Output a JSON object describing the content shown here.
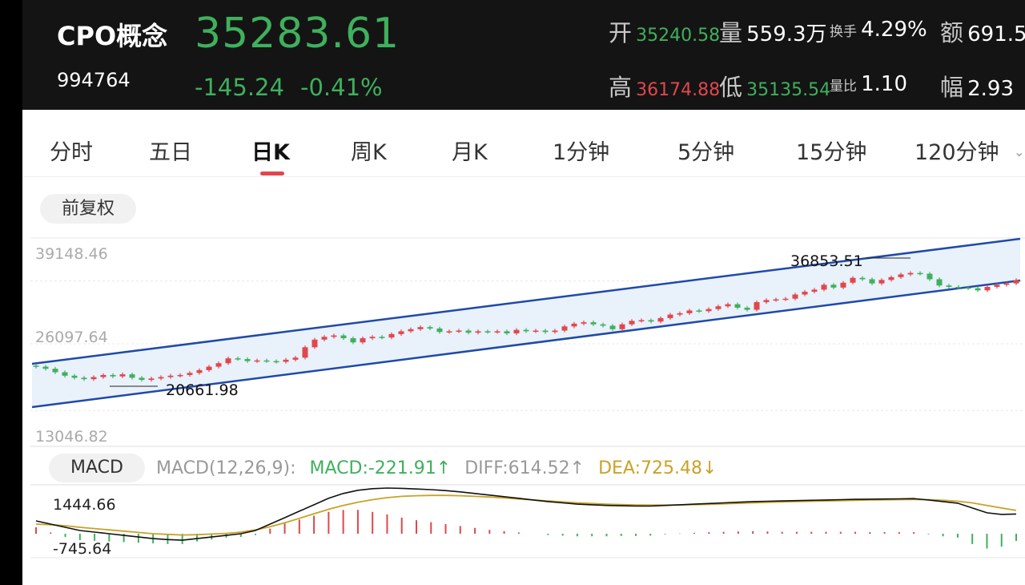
{
  "header": {
    "name": "CPO概念",
    "code": "994764",
    "price": "35283.61",
    "change": "-145.24",
    "change_pct": "-0.41%",
    "stats": {
      "open_label": "开",
      "open_value": "35240.58",
      "volume_label": "量",
      "volume_value": "559.3万",
      "turnover_label": "换手",
      "turnover_value": "4.29%",
      "amount_label": "额",
      "amount_value": "691.5",
      "high_label": "高",
      "high_value": "36174.88",
      "low_label": "低",
      "low_value": "35135.54",
      "vol_ratio_label": "量比",
      "vol_ratio_value": "1.10",
      "amplitude_label": "幅",
      "amplitude_value": "2.93"
    }
  },
  "tabs": [
    {
      "label": "分时"
    },
    {
      "label": "五日"
    },
    {
      "label": "日K"
    },
    {
      "label": "周K"
    },
    {
      "label": "月K"
    },
    {
      "label": "1分钟"
    },
    {
      "label": "5分钟"
    },
    {
      "label": "15分钟"
    },
    {
      "label": "120分钟"
    }
  ],
  "active_tab": "日K",
  "adjust_button": "前复权",
  "colors": {
    "up": "#e0474c",
    "down": "#3fb05d",
    "channel": "#1f4aa8",
    "dea": "#c9a227",
    "diff": "#111111"
  },
  "main_chart": {
    "y_labels": [
      "39148.46",
      "26097.64",
      "13046.82"
    ],
    "max_marker": "36853.51",
    "min_marker": "20661.98"
  },
  "macd": {
    "button": "MACD",
    "params": "MACD(12,26,9):",
    "macd_text": "MACD:-221.91↑",
    "diff_text": "DIFF:614.52↑",
    "dea_text": "DEA:725.48↓",
    "y_top": "1444.66",
    "y_bottom": "-745.64"
  },
  "chart_data": {
    "type": "candlestick",
    "ylim": [
      13046.82,
      39148.46
    ],
    "close": [
      22800,
      22500,
      22000,
      21500,
      21200,
      21000,
      21300,
      21600,
      21400,
      21700,
      21200,
      20900,
      21100,
      21300,
      21500,
      21600,
      21900,
      22300,
      22800,
      23300,
      24000,
      23900,
      23600,
      23700,
      23600,
      23500,
      23800,
      24100,
      25600,
      26700,
      27100,
      27300,
      26900,
      26300,
      26900,
      27100,
      27000,
      27500,
      27900,
      28200,
      28500,
      28300,
      27800,
      27900,
      28000,
      27700,
      27900,
      27800,
      27900,
      27600,
      28100,
      27900,
      28000,
      27800,
      28000,
      28600,
      29000,
      29200,
      28900,
      28700,
      28200,
      28900,
      29400,
      29500,
      29300,
      29800,
      30300,
      30500,
      30900,
      30800,
      31100,
      31500,
      31800,
      31300,
      31000,
      32100,
      32400,
      32500,
      32600,
      33200,
      33600,
      33900,
      34600,
      34200,
      34900,
      35600,
      35400,
      34800,
      35300,
      35700,
      36100,
      36300,
      36200,
      35400,
      34500,
      34300,
      34200,
      34100,
      33800,
      34300,
      34600,
      34800,
      35284
    ],
    "macd_diff": [
      400,
      300,
      200,
      100,
      50,
      0,
      -50,
      -100,
      -150,
      -180,
      -200,
      -150,
      -100,
      -50,
      0,
      100,
      300,
      500,
      700,
      900,
      1100,
      1250,
      1350,
      1400,
      1420,
      1410,
      1390,
      1370,
      1340,
      1300,
      1250,
      1200,
      1150,
      1100,
      1050,
      1000,
      960,
      920,
      900,
      880,
      870,
      860,
      860,
      880,
      900,
      920,
      940,
      960,
      980,
      1000,
      1010,
      1020,
      1030,
      1040,
      1050,
      1060,
      1070,
      1075,
      1080,
      1085,
      1090,
      1050,
      1000,
      950,
      800,
      650,
      600,
      614
    ],
    "macd_dea": [
      300,
      280,
      250,
      200,
      160,
      120,
      80,
      40,
      0,
      -20,
      -40,
      -30,
      -10,
      10,
      50,
      120,
      220,
      340,
      480,
      620,
      760,
      880,
      980,
      1060,
      1120,
      1160,
      1180,
      1190,
      1190,
      1180,
      1160,
      1140,
      1110,
      1080,
      1050,
      1020,
      990,
      960,
      940,
      920,
      905,
      895,
      890,
      890,
      895,
      905,
      915,
      930,
      945,
      960,
      975,
      990,
      1000,
      1010,
      1020,
      1030,
      1040,
      1050,
      1055,
      1060,
      1065,
      1060,
      1040,
      1010,
      960,
      880,
      800,
      725
    ]
  }
}
